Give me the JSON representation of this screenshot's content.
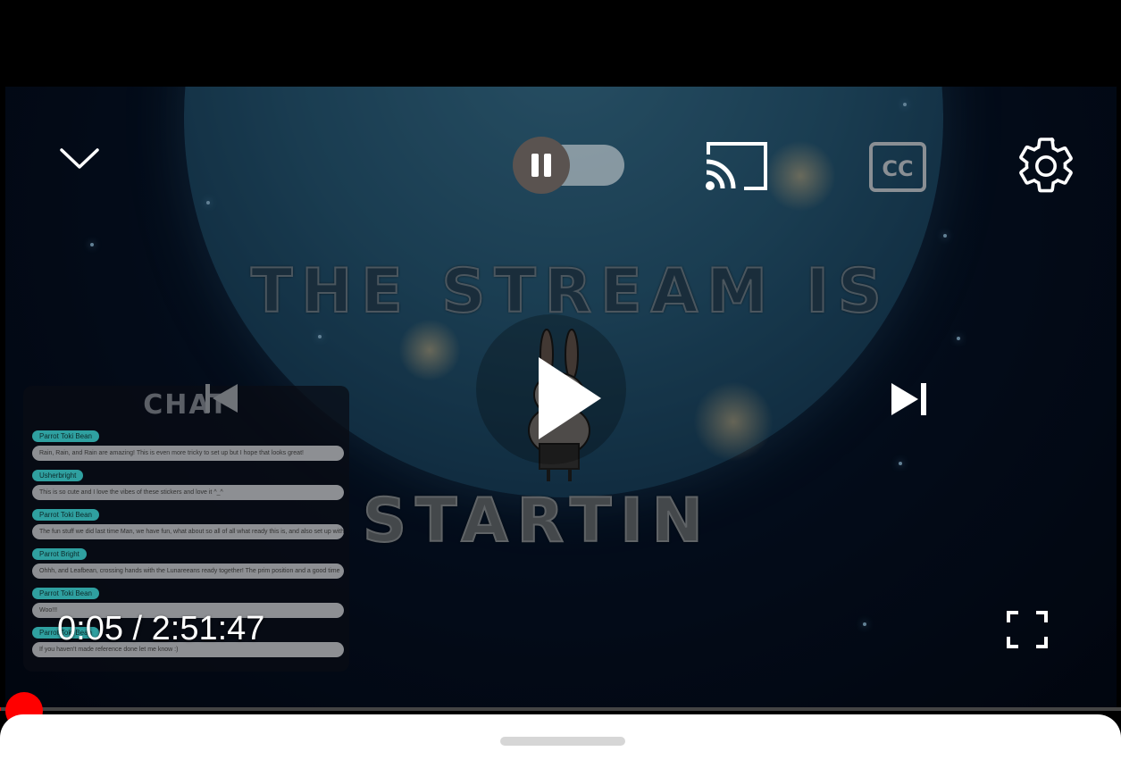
{
  "player": {
    "time_current": "0:05",
    "time_separator": " / ",
    "time_total": "2:51:47",
    "progress_fraction": 0.0005,
    "autoplay_enabled": false
  },
  "video": {
    "title_line1": "THE STREAM IS",
    "title_line2": "STARTIN"
  },
  "chat": {
    "header": "CHAT",
    "messages": [
      {
        "name": "Parrot Toki Bean",
        "text": "Rain, Rain, and Rain are amazing! This is even more tricky to set up but I hope that looks great!"
      },
      {
        "name": "Usherbright",
        "text": "This is so cute and I love the vibes of these stickers and love it ^_^"
      },
      {
        "name": "Parrot Toki Bean",
        "text": "The fun stuff we did last time Man, we have fun, what about so all of all what ready this is, and also set up with stream cheers"
      },
      {
        "name": "Parrot Bright",
        "text": "Ohhh, and Leafbean, crossing hands with the Lunareeans ready together! The prim position and a good time"
      },
      {
        "name": "Parrot Toki Bean",
        "text": "Woo!!!"
      },
      {
        "name": "Parrot Toki Bean",
        "text": "If you haven't made reference done let me know :)"
      }
    ]
  },
  "icons": {
    "minimize": "chevron-down-icon",
    "autoplay": "pause-toggle-icon",
    "cast": "cast-icon",
    "captions": "cc-icon",
    "settings": "gear-icon",
    "previous": "skip-previous-icon",
    "play": "play-icon",
    "next": "skip-next-icon",
    "fullscreen": "fullscreen-icon"
  },
  "colors": {
    "progress": "#ff0000",
    "chat_name_bg": "#2fa0a0"
  }
}
